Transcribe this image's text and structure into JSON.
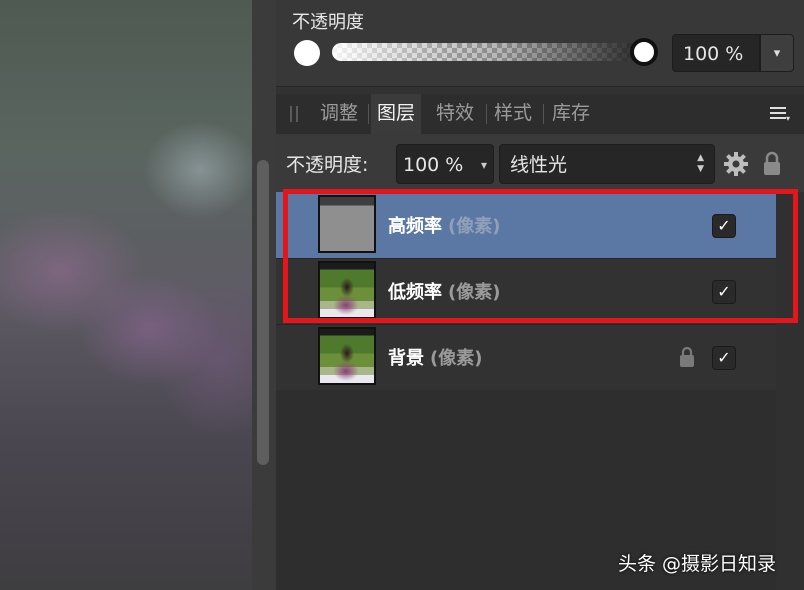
{
  "opacity_section": {
    "title": "不透明度",
    "value": "100 %",
    "level_percent": 100
  },
  "tabs": [
    {
      "label": "调整",
      "active": false
    },
    {
      "label": "图层",
      "active": true
    },
    {
      "label": "特效",
      "active": false
    },
    {
      "label": "样式",
      "active": false
    },
    {
      "label": "库存",
      "active": false
    }
  ],
  "controls": {
    "opacity_label": "不透明度:",
    "opacity_value": "100 %",
    "blend_mode": "线性光"
  },
  "layers": [
    {
      "name": "高频率",
      "type": "(像素)",
      "visible": true,
      "selected": true,
      "locked": false
    },
    {
      "name": "低频率",
      "type": "(像素)",
      "visible": true,
      "selected": false,
      "locked": false
    },
    {
      "name": "背景",
      "type": "(像素)",
      "visible": true,
      "selected": false,
      "locked": true
    }
  ],
  "icons": {
    "check": "✓",
    "dropdown": "▾",
    "updown": "▲▼"
  },
  "colors": {
    "selection": "#5b78a4",
    "highlight": "#e4151b",
    "panel_bg": "#323232"
  },
  "watermark": "头条 @摄影日知录"
}
